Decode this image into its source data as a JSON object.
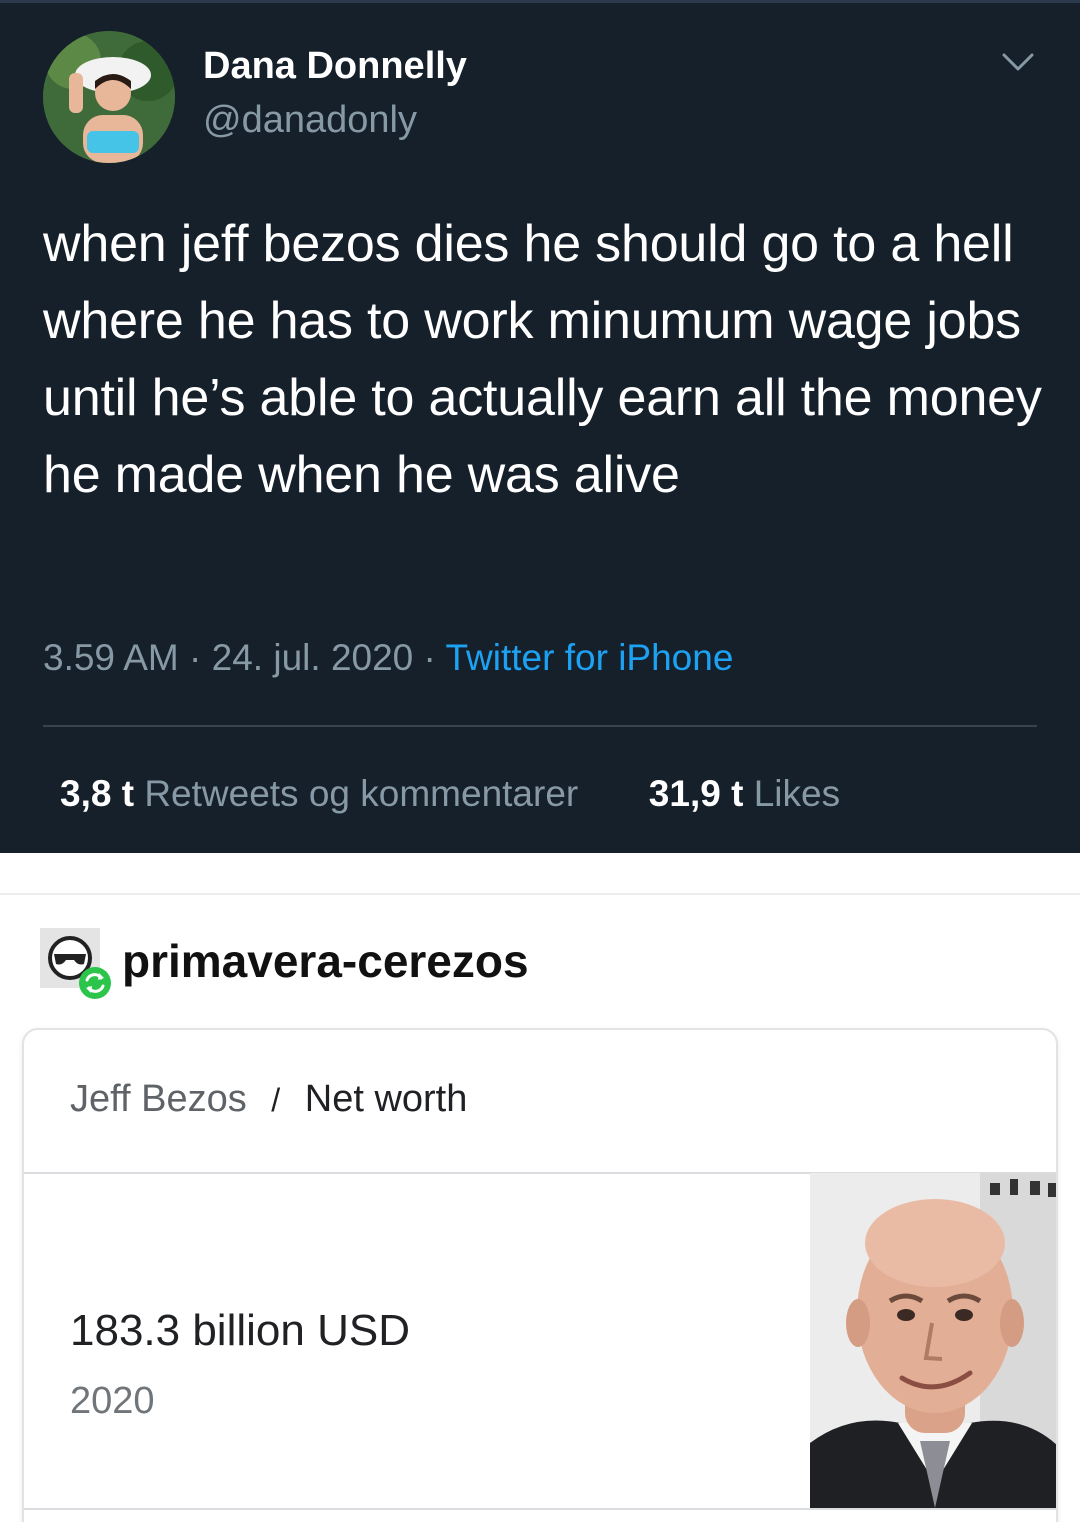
{
  "tweet": {
    "display_name": "Dana Donnelly",
    "handle": "@danadonly",
    "text": "when jeff bezos dies he should go to a hell where he has to work minumum wage jobs until he’s able to actually earn all the money he made when he was alive",
    "time": "3.59 AM",
    "date": "24. jul. 2020",
    "dot": "·",
    "source": "Twitter for iPhone",
    "retweets_count": "3,8 t",
    "retweets_label": "Retweets og kommentarer",
    "likes_count": "31,9 t",
    "likes_label": "Likes"
  },
  "reblog": {
    "blog_name": "primavera-cerezos"
  },
  "card": {
    "breadcrumb_parent": "Jeff Bezos",
    "breadcrumb_sep": "/",
    "breadcrumb_current": "Net worth",
    "value": "183.3 billion USD",
    "year": "2020"
  },
  "icons": {
    "menu": "chevron-down-icon",
    "blog_avatar": "sunglasses-face-icon",
    "reblog_badge": "reblog-icon"
  },
  "colors": {
    "tweet_bg": "#15202b",
    "muted": "#8899a6",
    "link": "#1da1f2",
    "reblog_green": "#2ac54a"
  }
}
